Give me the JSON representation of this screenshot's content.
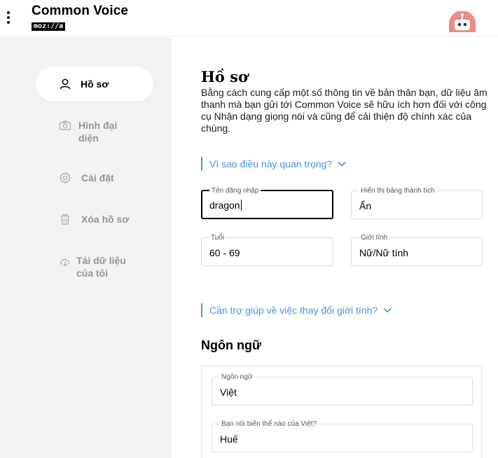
{
  "header": {
    "brand": "Common Voice",
    "brand_sub": "moz://a"
  },
  "sidebar": {
    "items": [
      {
        "label": "Hồ sơ",
        "icon": "user-icon",
        "active": true
      },
      {
        "label": "Hình đại diện",
        "icon": "camera-icon",
        "active": false
      },
      {
        "label": "Cài đặt",
        "icon": "gear-icon",
        "active": false
      },
      {
        "label": "Xóa hồ sơ",
        "icon": "trash-icon",
        "active": false
      },
      {
        "label": "Tải dữ liệu của tôi",
        "icon": "cloud-download-icon",
        "active": false
      }
    ]
  },
  "main": {
    "title": "Hồ sơ",
    "description": "Bằng cách cung cấp một số thông tin về bản thân bạn, dữ liệu âm thanh mà bạn gửi tới Common Voice sẽ hữu ích hơn đối với công cụ Nhận dạng giọng nói và cũng để cải thiện độ chính xác của chúng.",
    "why_link": "Vì sao điều này quan trọng?",
    "username": {
      "label": "Tên đăng nhập",
      "value": "dragon"
    },
    "leaderboard": {
      "label": "Hiển thị bảng thành tích",
      "value": "Ẩn"
    },
    "age": {
      "label": "Tuổi",
      "value": "60 - 69"
    },
    "gender": {
      "label": "Giới tính",
      "value": "Nữ/Nữ tính"
    },
    "gender_help_link": "Cần trợ giúp về việc thay đổi giới tính?",
    "languages": {
      "title": "Ngôn ngữ",
      "language": {
        "label": "Ngôn ngữ",
        "value": "Việt"
      },
      "variant": {
        "label": "Bạn nói biến thể nào của Việt?",
        "value": "Huế"
      }
    }
  },
  "colors": {
    "accent": "#4a90e2",
    "sidebar_bg": "#f2f2f2",
    "inactive_text": "#959595"
  }
}
